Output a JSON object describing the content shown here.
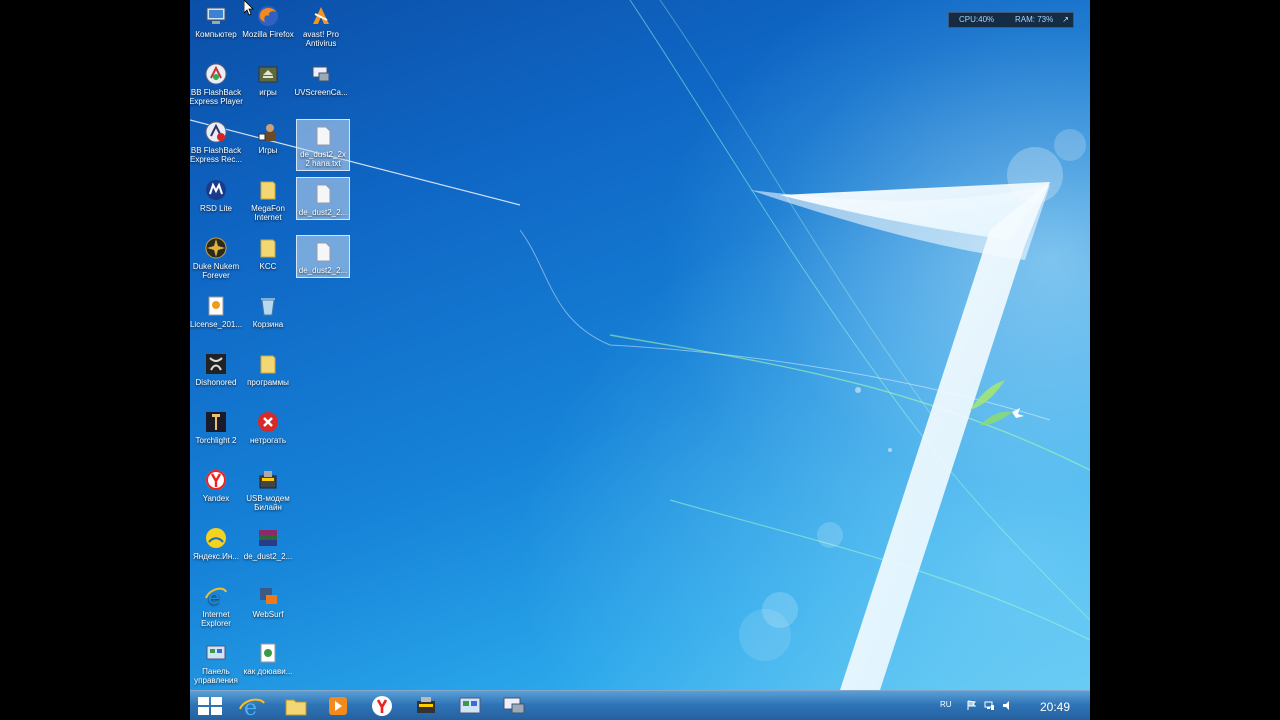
{
  "system_monitor": {
    "cpu": "CPU:40%",
    "ram": "RAM: 73%"
  },
  "taskbar": {
    "language": "RU",
    "clock": "20:49"
  },
  "desktop_icons": [
    {
      "label": "Компьютер"
    },
    {
      "label": "Mozilla Firefox"
    },
    {
      "label": "avast! Pro Antivirus"
    },
    {
      "label": "BB FlashBack Express Player"
    },
    {
      "label": "игры"
    },
    {
      "label": "UVScreenCa..."
    },
    {
      "label": "BB FlashBack Express Rec..."
    },
    {
      "label": "Игры"
    },
    {
      "label": "de_dust2_2x2 hana.txt"
    },
    {
      "label": "RSD Lite"
    },
    {
      "label": "MegaFon Internet"
    },
    {
      "label": "de_dust2_2..."
    },
    {
      "label": "Duke Nukem Forever"
    },
    {
      "label": "KCC"
    },
    {
      "label": "de_dust2_2..."
    },
    {
      "label": "License_201..."
    },
    {
      "label": "Корзина"
    },
    {
      "label": "Dishonored"
    },
    {
      "label": "программы"
    },
    {
      "label": "Torchlight 2"
    },
    {
      "label": "нетрогать"
    },
    {
      "label": "Yandex"
    },
    {
      "label": "USB-модем Билайн"
    },
    {
      "label": "Яндекс.Ин..."
    },
    {
      "label": "de_dust2_2..."
    },
    {
      "label": "Internet Explorer"
    },
    {
      "label": "WebSurf"
    },
    {
      "label": "Панель управления"
    },
    {
      "label": "как доюави..."
    }
  ]
}
